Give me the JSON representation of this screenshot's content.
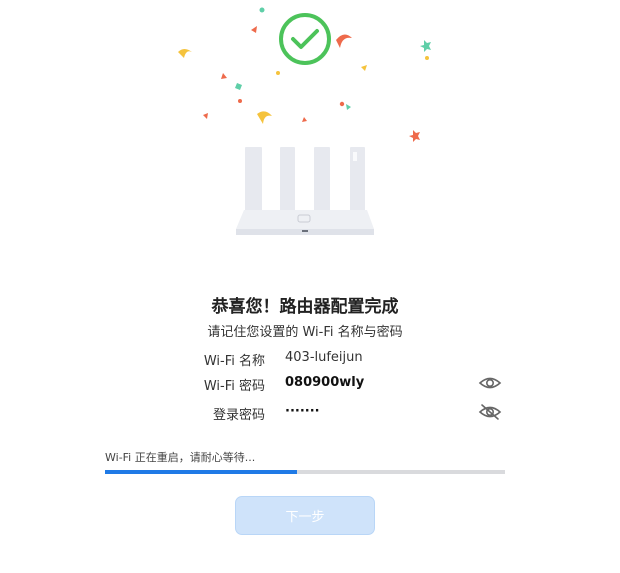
{
  "colors": {
    "success": "#4cc35a",
    "accent": "#1f7ae6",
    "button_disabled": "#cfe3fa"
  },
  "success": {
    "title": "恭喜您！路由器配置完成",
    "subtitle": "请记住您设置的 Wi-Fi 名称与密码"
  },
  "details": {
    "wifi_name_label": "Wi-Fi 名称",
    "wifi_name_value": "403-lufeijun",
    "wifi_password_label": "Wi-Fi 密码",
    "wifi_password_value": "080900wly",
    "login_password_label": "登录密码",
    "login_password_value": "·······"
  },
  "icons": {
    "wifi_password_toggle": "eye-open-icon",
    "login_password_toggle": "eye-closed-icon"
  },
  "restart": {
    "status_text": "Wi-Fi 正在重启，请耐心等待...",
    "progress": 0.48
  },
  "actions": {
    "next_label": "下一步"
  }
}
